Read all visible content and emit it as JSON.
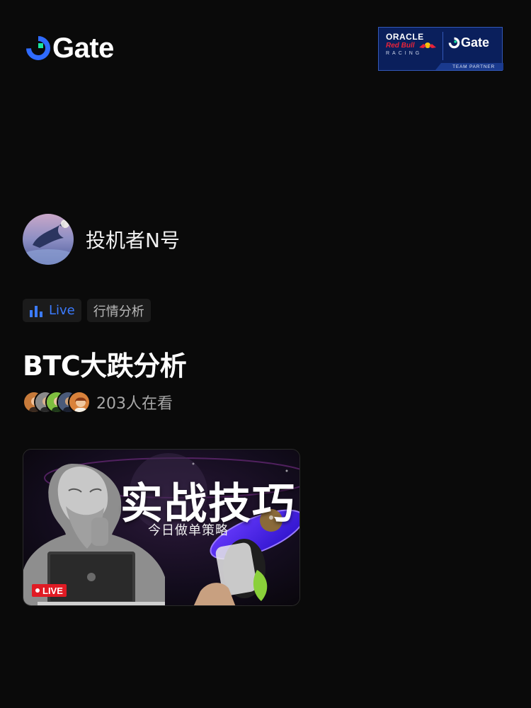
{
  "header": {
    "brand": "Gate",
    "partner": {
      "line1": "ORACLE",
      "line2": "Red Bull",
      "line3": "RACING",
      "brand": "Gate",
      "footer": "TEAM PARTNER"
    }
  },
  "author": {
    "name": "投机者N号"
  },
  "tags": [
    {
      "label": "Live",
      "icon": "bar-chart-icon",
      "color": "#3b7bff"
    },
    {
      "label": "行情分析"
    }
  ],
  "stream": {
    "title": "BTC大跌分析",
    "viewers": "203人在看",
    "cover": {
      "title": "实战技巧",
      "subtitle": "今日做单策略",
      "badge": "LIVE"
    }
  },
  "colors": {
    "background": "#0a0a0a",
    "accent": "#3b7bff",
    "brand_green": "#17e5a0",
    "live_red": "#e01b24",
    "partner_navy": "#0a1f5c"
  }
}
